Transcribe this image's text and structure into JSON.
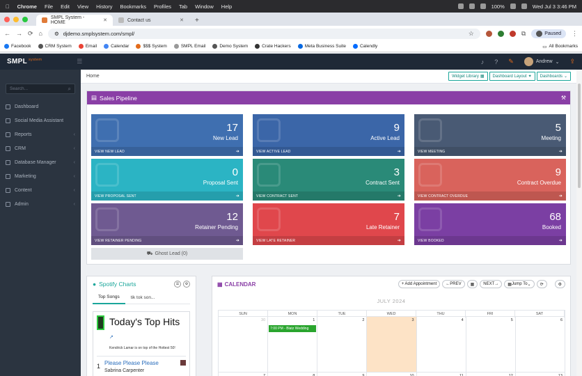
{
  "macbar": {
    "app": "Chrome",
    "menus": [
      "File",
      "Edit",
      "View",
      "History",
      "Bookmarks",
      "Profiles",
      "Tab",
      "Window",
      "Help"
    ],
    "battery": "100%",
    "datetime": "Wed Jul 3  3:46 PM"
  },
  "tabs": [
    {
      "title": "SMPL System - HOME",
      "active": true
    },
    {
      "title": "Contact us",
      "active": false
    }
  ],
  "address": {
    "url": "djdemo.smplsystem.com/smpl/",
    "profile_label": "Paused"
  },
  "bookmarks": {
    "items": [
      "Facebook",
      "CRM System",
      "Email",
      "Calendar",
      "$$$ System",
      "SMPL Email",
      "Demo System",
      "Crate Hackers",
      "Meta Business Suite",
      "Calendly"
    ],
    "all_label": "All Bookmarks"
  },
  "app": {
    "logo": "SMPL",
    "logo_sub": "system",
    "user": "Andrew"
  },
  "sidebar": {
    "search_placeholder": "Search...",
    "items": [
      {
        "label": "Dashboard",
        "chevron": false
      },
      {
        "label": "Social Media Assistant",
        "chevron": false
      },
      {
        "label": "Reports",
        "chevron": true
      },
      {
        "label": "CRM",
        "chevron": true
      },
      {
        "label": "Database Manager",
        "chevron": true
      },
      {
        "label": "Marketing",
        "chevron": true
      },
      {
        "label": "Content",
        "chevron": true
      },
      {
        "label": "Admin",
        "chevron": true
      }
    ]
  },
  "breadcrumb": "Home",
  "header_buttons": [
    "Widget Library",
    "Dashboard Layout",
    "Dashboards"
  ],
  "pipeline": {
    "title": "Sales Pipeline",
    "tiles": [
      {
        "count": "17",
        "label": "New Lead",
        "link": "VIEW NEW LEAD",
        "color": "#3f6fb0"
      },
      {
        "count": "9",
        "label": "Active Lead",
        "link": "VIEW ACTIVE LEAD",
        "color": "#3b66a8"
      },
      {
        "count": "5",
        "label": "Meeting",
        "link": "VIEW MEETING",
        "color": "#495a74"
      },
      {
        "count": "0",
        "label": "Proposal Sent",
        "link": "VIEW PROPOSAL SENT",
        "color": "#2bb4c4"
      },
      {
        "count": "3",
        "label": "Contract Sent",
        "link": "VIEW CONTRACT SENT",
        "color": "#2a8a78"
      },
      {
        "count": "9",
        "label": "Contract Overdue",
        "link": "VIEW CONTRACT OVERDUE",
        "color": "#d9635c"
      },
      {
        "count": "12",
        "label": "Retainer Pending",
        "link": "VIEW RETAINER PENDING",
        "color": "#6f5a91"
      },
      {
        "count": "7",
        "label": "Late Retainer",
        "link": "VIEW LATE RETAINER",
        "color": "#e0474c"
      },
      {
        "count": "68",
        "label": "Booked",
        "link": "VIEW BOOKED",
        "color": "#7b3fa3"
      }
    ],
    "ghost": "Ghost Lead (0)"
  },
  "spotify": {
    "title": "Spotify Charts",
    "tabs": [
      "Top Songs",
      "tik tok son..."
    ],
    "playlist_title": "Today's Top Hits",
    "playlist_sub": "Kendrick Lamar is on top of the Hottest 50!",
    "row": {
      "rank": "1",
      "song": "Please Please Please",
      "artist": "Sabrina Carpenter"
    }
  },
  "calendar": {
    "title": "CALENDAR",
    "buttons": [
      "+ Add Appointment",
      "PREV",
      "NEXT",
      "Jump To"
    ],
    "month": "JULY 2024",
    "dow": [
      "SUN",
      "MON",
      "TUE",
      "WED",
      "THU",
      "FRI",
      "SAT"
    ],
    "week1": [
      "30",
      "1",
      "2",
      "3",
      "4",
      "5",
      "6"
    ],
    "week2": [
      "7",
      "8",
      "9",
      "10",
      "11",
      "12",
      "13"
    ],
    "event": "7:00 PM - Blatz Wedding"
  }
}
